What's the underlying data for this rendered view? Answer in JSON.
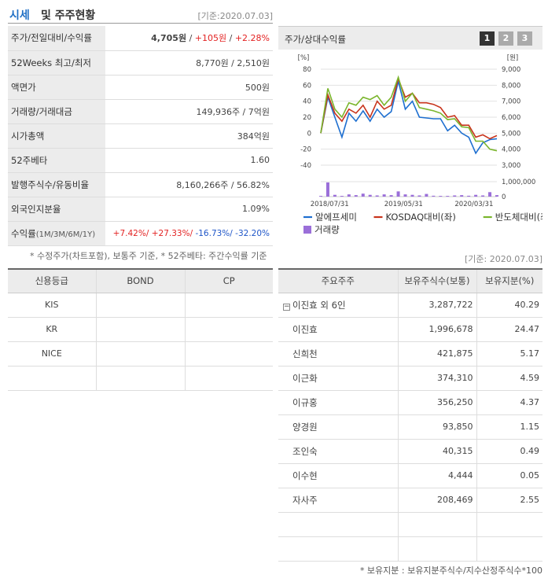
{
  "header": {
    "title_highlight": "시세",
    "title_rest": "및 주주현황",
    "base_date": "[기준:2020.07.03]"
  },
  "summary": [
    {
      "key": "주가/전일대비/수익률",
      "price": "4,705원",
      "diff": "+105원",
      "rate": "+2.28%"
    },
    {
      "key": "52Weeks 최고/최저",
      "value": "8,770원 / 2,510원"
    },
    {
      "key": "액면가",
      "value": "500원"
    },
    {
      "key": "거래량/거래대금",
      "value": "149,936주 / 7억원"
    },
    {
      "key": "시가총액",
      "value": "384억원"
    },
    {
      "key": "52주베타",
      "value": "1.60"
    },
    {
      "key": "발행주식수/유동비율",
      "value": "8,160,266주 / 56.82%"
    },
    {
      "key": "외국인지분율",
      "value": "1.09%"
    },
    {
      "key": "수익률",
      "key_sub": "(1M/3M/6M/1Y)",
      "r1": "+7.42%",
      "r2": "+27.33%",
      "r3": "-16.73%",
      "r4": "-32.20%"
    }
  ],
  "summary_note": "* 수정주가(차트포함), 보통주 기준, * 52주베타: 주간수익률 기준",
  "chart_panel": {
    "title": "주가/상대수익률",
    "tabs": [
      "1",
      "2",
      "3"
    ],
    "active_tab": "1"
  },
  "chart_data": {
    "type": "line",
    "y_left_unit": "[%]",
    "y_right_unit": "[원]",
    "y_left_ticks": [
      "80",
      "60",
      "40",
      "20",
      "0",
      "-20",
      "-40"
    ],
    "y_right_ticks": [
      "9,000",
      "8,000",
      "7,000",
      "6,000",
      "5,000",
      "4,000",
      "3,000"
    ],
    "vol_ticks": [
      "1,000,000",
      "0"
    ],
    "ylim_left": [
      -40,
      80
    ],
    "ylim_right": [
      3000,
      9000
    ],
    "x_labels": [
      "2018/07/31",
      "2019/05/31",
      "2020/03/31"
    ],
    "series": [
      {
        "name": "알에프세미",
        "color": "#1e6fd0",
        "values": [
          0,
          45,
          20,
          -5,
          25,
          15,
          28,
          15,
          30,
          20,
          27,
          65,
          30,
          40,
          20,
          19,
          18,
          18,
          3,
          10,
          0,
          -5,
          -25,
          -12,
          -8,
          -7
        ]
      },
      {
        "name": "KOSDAQ대비(좌)",
        "color": "#c8341c",
        "values": [
          0,
          48,
          25,
          15,
          30,
          25,
          35,
          20,
          40,
          30,
          35,
          68,
          45,
          50,
          38,
          38,
          36,
          32,
          20,
          22,
          10,
          10,
          -5,
          -2,
          -7,
          -3
        ]
      },
      {
        "name": "반도체대비(좌)",
        "color": "#7ab52c",
        "values": [
          0,
          56,
          30,
          20,
          38,
          35,
          45,
          42,
          47,
          35,
          45,
          70,
          40,
          50,
          32,
          30,
          28,
          25,
          17,
          18,
          8,
          7,
          -10,
          -10,
          -20,
          -22
        ]
      }
    ],
    "volume": {
      "name": "거래량",
      "color": "#9b6fd9",
      "values": [
        0.05,
        0.95,
        0.12,
        0.05,
        0.15,
        0.1,
        0.2,
        0.12,
        0.08,
        0.15,
        0.1,
        0.35,
        0.15,
        0.12,
        0.08,
        0.18,
        0.06,
        0.05,
        0.05,
        0.08,
        0.1,
        0.06,
        0.12,
        0.08,
        0.3,
        0.1
      ]
    }
  },
  "base_date_2": "[기준: 2020.07.03]",
  "credit": {
    "headers": [
      "신용등급",
      "BOND",
      "CP"
    ],
    "rows": [
      [
        "KIS",
        "",
        ""
      ],
      [
        "KR",
        "",
        ""
      ],
      [
        "NICE",
        "",
        ""
      ],
      [
        "",
        "",
        ""
      ]
    ]
  },
  "holders": {
    "headers": [
      "주요주주",
      "보유주식수(보통)",
      "보유지분(%)"
    ],
    "group": {
      "name": "이진효 외 6인",
      "shares": "3,287,722",
      "pct": "40.29"
    },
    "rows": [
      {
        "name": "이진효",
        "shares": "1,996,678",
        "pct": "24.47"
      },
      {
        "name": "신희천",
        "shares": "421,875",
        "pct": "5.17"
      },
      {
        "name": "이근화",
        "shares": "374,310",
        "pct": "4.59"
      },
      {
        "name": "이규홍",
        "shares": "356,250",
        "pct": "4.37"
      },
      {
        "name": "양경원",
        "shares": "93,850",
        "pct": "1.15"
      },
      {
        "name": "조인숙",
        "shares": "40,315",
        "pct": "0.49"
      },
      {
        "name": "이수현",
        "shares": "4,444",
        "pct": "0.05"
      }
    ],
    "treasury": {
      "name": "자사주",
      "shares": "208,469",
      "pct": "2.55"
    },
    "note": "* 보유지분 : 보유지분주식수/지수산정주식수*100"
  }
}
